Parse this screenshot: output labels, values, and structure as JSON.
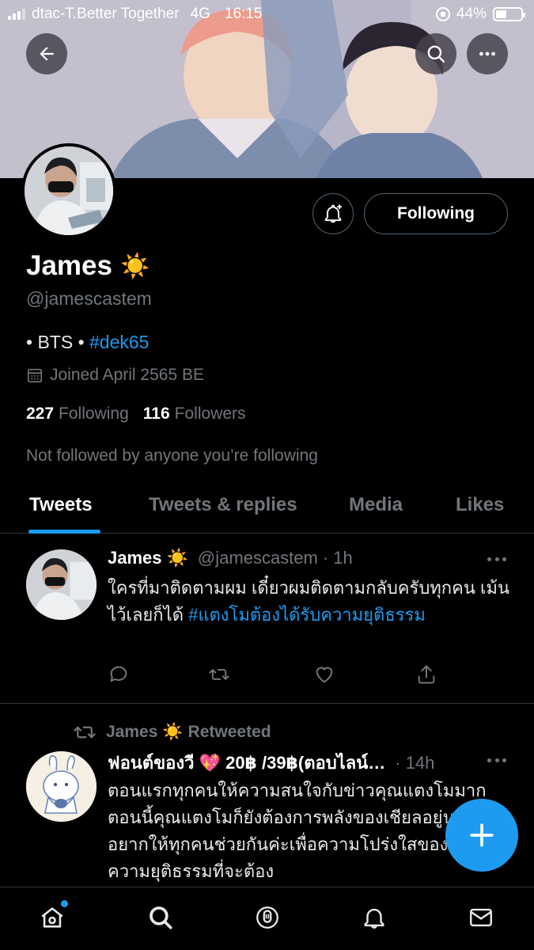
{
  "status_bar": {
    "carrier": "dtac-T.Better Together",
    "network": "4G",
    "time": "16:15",
    "battery_percent": "44%",
    "battery_level": 0.44
  },
  "profile": {
    "name": "James",
    "name_emoji": "☀️",
    "handle": "@jamescastem",
    "bio_prefix": "• BTS • ",
    "bio_hashtag": "#dek65",
    "joined": "Joined April 2565 BE",
    "following_count": "227",
    "following_label": "Following",
    "followers_count": "116",
    "followers_label": "Followers",
    "not_followed": "Not followed by anyone you’re following",
    "following_button": "Following"
  },
  "tabs": [
    {
      "label": "Tweets",
      "active": true
    },
    {
      "label": "Tweets & replies",
      "active": false
    },
    {
      "label": "Media",
      "active": false
    },
    {
      "label": "Likes",
      "active": false
    }
  ],
  "tweets": [
    {
      "name": "James",
      "name_emoji": "☀️",
      "handle": "@jamescastem",
      "time": "· 1h",
      "text_plain": "ใครที่มาติดตามผม เดี๋ยวผมติดตามกลับครับทุกคน เม้นไว้เลยก็ได้ ",
      "text_hashtag": "#แตงโมต้องได้รับความยุติธรรม"
    },
    {
      "retweeted_by": "James",
      "retweeted_emoji": "☀️",
      "retweeted_label": "Retweeted",
      "name": "ฟอนต์ของวี 💖 20฿ /39฿(ตอบไลน์…",
      "time": "· 14h",
      "text": "ตอนแรกทุกคนให้ความสนใจกับข่าวคุณแตงโมมาก ตอนนี้คุณแตงโมก็ยังต้องการพลังของเชียลอยู่นะคะ อยากให้ทุกคนช่วยกันค่ะเพื่อความโปร่งใสของคดีและความยุติธรรมที่จะต้อง"
    }
  ],
  "colors": {
    "accent": "#1d9bf0",
    "background": "#000000",
    "muted": "#71767b"
  }
}
